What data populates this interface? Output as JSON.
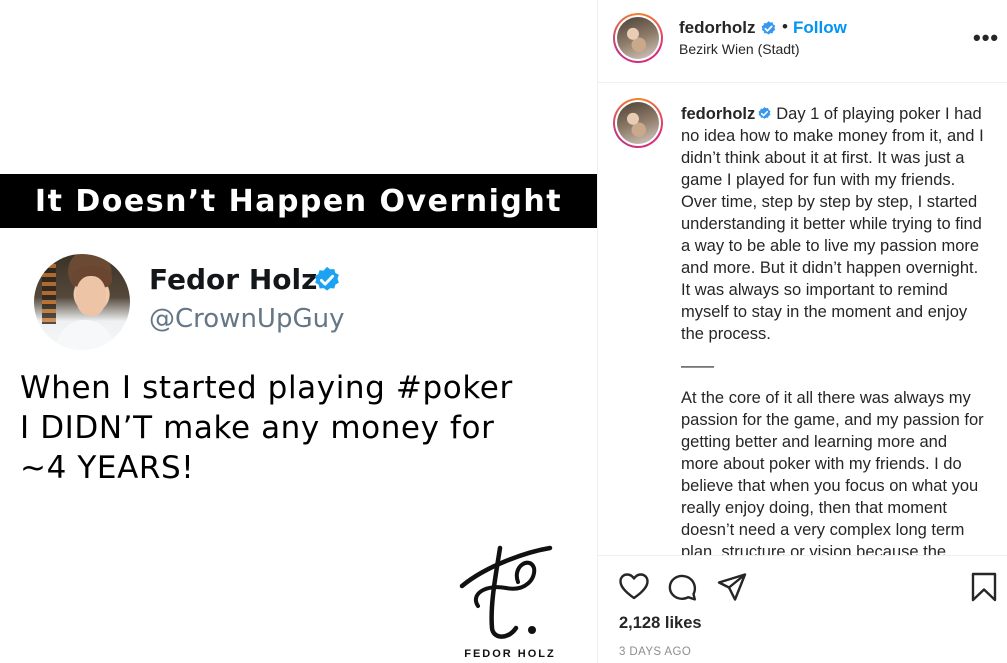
{
  "post_image": {
    "banner_text": "It Doesn’t Happen Overnight",
    "tweet": {
      "name": "Fedor Holz",
      "handle": "@CrownUpGuy",
      "text_lines": [
        "When I started playing #poker",
        "I DIDN’T make any money for",
        "~4 YEARS!"
      ]
    },
    "signature_caption": "FEDOR HOLZ"
  },
  "header": {
    "username": "fedorholz",
    "separator": "•",
    "follow_label": "Follow",
    "location": "Bezirk Wien (Stadt)",
    "more_label": "•••"
  },
  "caption": {
    "username": "fedorholz",
    "paragraph1": "Day 1 of playing poker I had no idea how to make money from it, and I didn’t think about it at first. It was just a game I played for fun with my friends. Over time, step by step by step, I started understanding it better while trying to find a way to be able to live my passion more and more. But it didn’t happen overnight. It was always so important to remind myself to stay in the moment and enjoy the process.",
    "separator": "——",
    "paragraph2": "At the core of it all there was always my passion for the game, and my passion for getting better and learning more and more about poker with my friends. I do believe that when you focus on what you really enjoy doing, then that moment doesn’t need a very complex long term plan, structure or vision because the moment itself is"
  },
  "actions": {
    "icons": [
      "heart-icon",
      "comment-icon",
      "share-icon",
      "bookmark-icon"
    ]
  },
  "likes_text": "2,128 likes",
  "time_ago": "3 DAYS AGO",
  "colors": {
    "accent_blue": "#0095f6",
    "verified_blue": "#3897f0",
    "text": "#262626",
    "muted": "#8e8e8e",
    "banner": "#000000"
  }
}
